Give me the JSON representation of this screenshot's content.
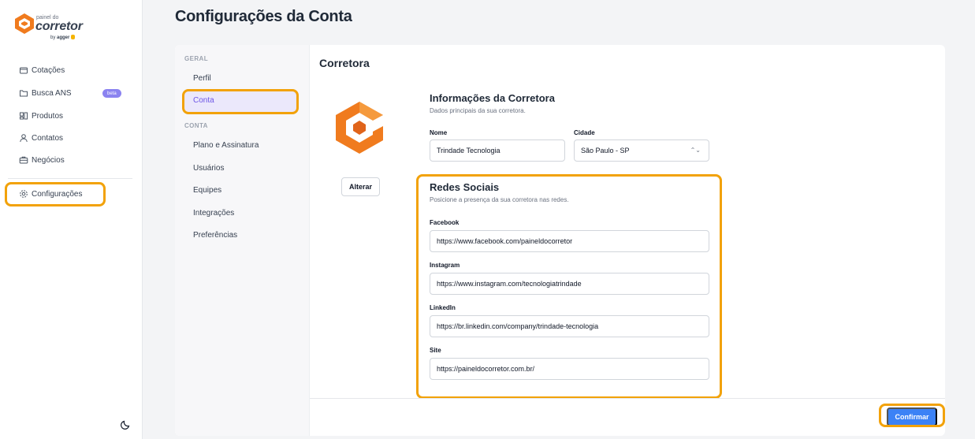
{
  "logo": {
    "small": "painel do",
    "main": "corretor",
    "by_prefix": "by ",
    "by_brand": "agger"
  },
  "sidebar": {
    "items": [
      {
        "label": "Cotações",
        "icon": "box-icon"
      },
      {
        "label": "Busca ANS",
        "icon": "folder-icon",
        "badge": "beta"
      },
      {
        "label": "Produtos",
        "icon": "products-icon"
      },
      {
        "label": "Contatos",
        "icon": "user-icon"
      },
      {
        "label": "Negócios",
        "icon": "briefcase-icon"
      },
      {
        "label": "Configurações",
        "icon": "gear-icon"
      }
    ],
    "theme_toggle_icon": "moon-icon"
  },
  "page": {
    "title": "Configurações da Conta"
  },
  "settings_nav": {
    "group_geral": "GERAL",
    "geral_items": [
      "Perfil",
      "Conta"
    ],
    "group_conta": "CONTA",
    "conta_items": [
      "Plano e Assinatura",
      "Usuários",
      "Equipes",
      "Integrações",
      "Preferências"
    ],
    "active": "Conta"
  },
  "corretora": {
    "section_title": "Corretora",
    "alter_button": "Alterar",
    "info_title": "Informações da Corretora",
    "info_desc": "Dados principais da sua corretora.",
    "nome_label": "Nome",
    "nome_value": "Trindade Tecnologia",
    "cidade_label": "Cidade",
    "cidade_value": "São Paulo - SP",
    "redes_title": "Redes Sociais",
    "redes_desc": "Posicione a presença da sua corretora nas redes.",
    "facebook_label": "Facebook",
    "facebook_value": "https://www.facebook.com/paineldocorretor",
    "instagram_label": "Instagram",
    "instagram_value": "https://www.instagram.com/tecnologiatrindade",
    "linkedin_label": "LinkedIn",
    "linkedin_value": "https://br.linkedin.com/company/trindade-tecnologia",
    "site_label": "Site",
    "site_value": "https://paineldocorretor.com.br/",
    "confirm_button": "Confirmar"
  },
  "colors": {
    "accent": "#6d56e6",
    "highlight": "#f2a20a",
    "primary_button": "#3b82f6",
    "brand_orange": "#f07b1e"
  }
}
